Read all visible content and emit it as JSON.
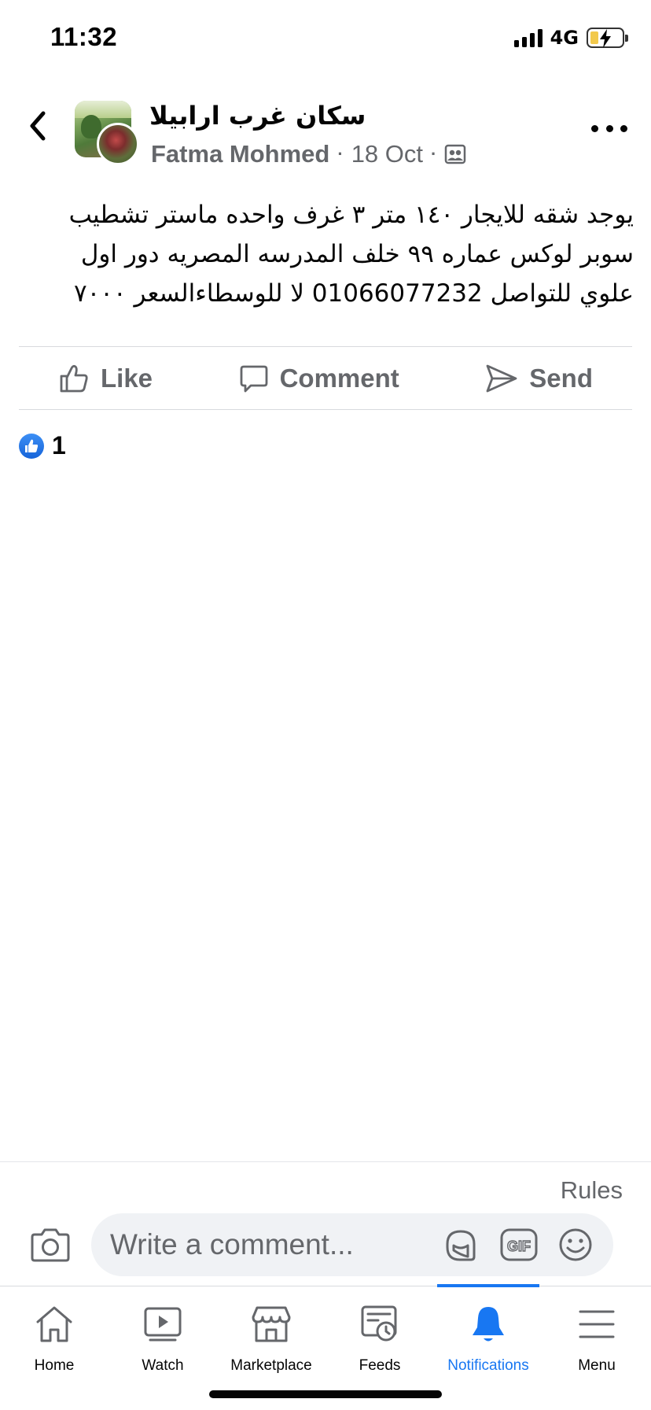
{
  "status_bar": {
    "time": "11:32",
    "network": "4G"
  },
  "post": {
    "group_name": "سكان غرب ارابيلا",
    "author": "Fatma Mohmed",
    "separator": "·",
    "date": "18 Oct",
    "privacy_icon": "members-icon",
    "text": "يوجد شقه للايجار ١٤٠ متر ٣ غرف واحده ماستر تشطيب سوبر لوكس عماره ٩٩ خلف المدرسه المصريه دور اول علوي للتواصل 01066077232 لا للوسطاءالسعر ٧٠٠٠"
  },
  "actions": {
    "like": "Like",
    "comment": "Comment",
    "send": "Send"
  },
  "reactions": {
    "count": "1",
    "icon": "like-reaction-icon"
  },
  "composer": {
    "rules": "Rules",
    "placeholder": "Write a comment..."
  },
  "tabs": [
    {
      "label": "Home",
      "icon": "home-icon"
    },
    {
      "label": "Watch",
      "icon": "watch-icon"
    },
    {
      "label": "Marketplace",
      "icon": "marketplace-icon"
    },
    {
      "label": "Feeds",
      "icon": "feeds-icon"
    },
    {
      "label": "Notifications",
      "icon": "bell-icon",
      "active": true
    },
    {
      "label": "Menu",
      "icon": "menu-icon"
    }
  ],
  "colors": {
    "accent": "#1877f2",
    "secondary_text": "#65676b",
    "input_bg": "#f0f2f5"
  }
}
